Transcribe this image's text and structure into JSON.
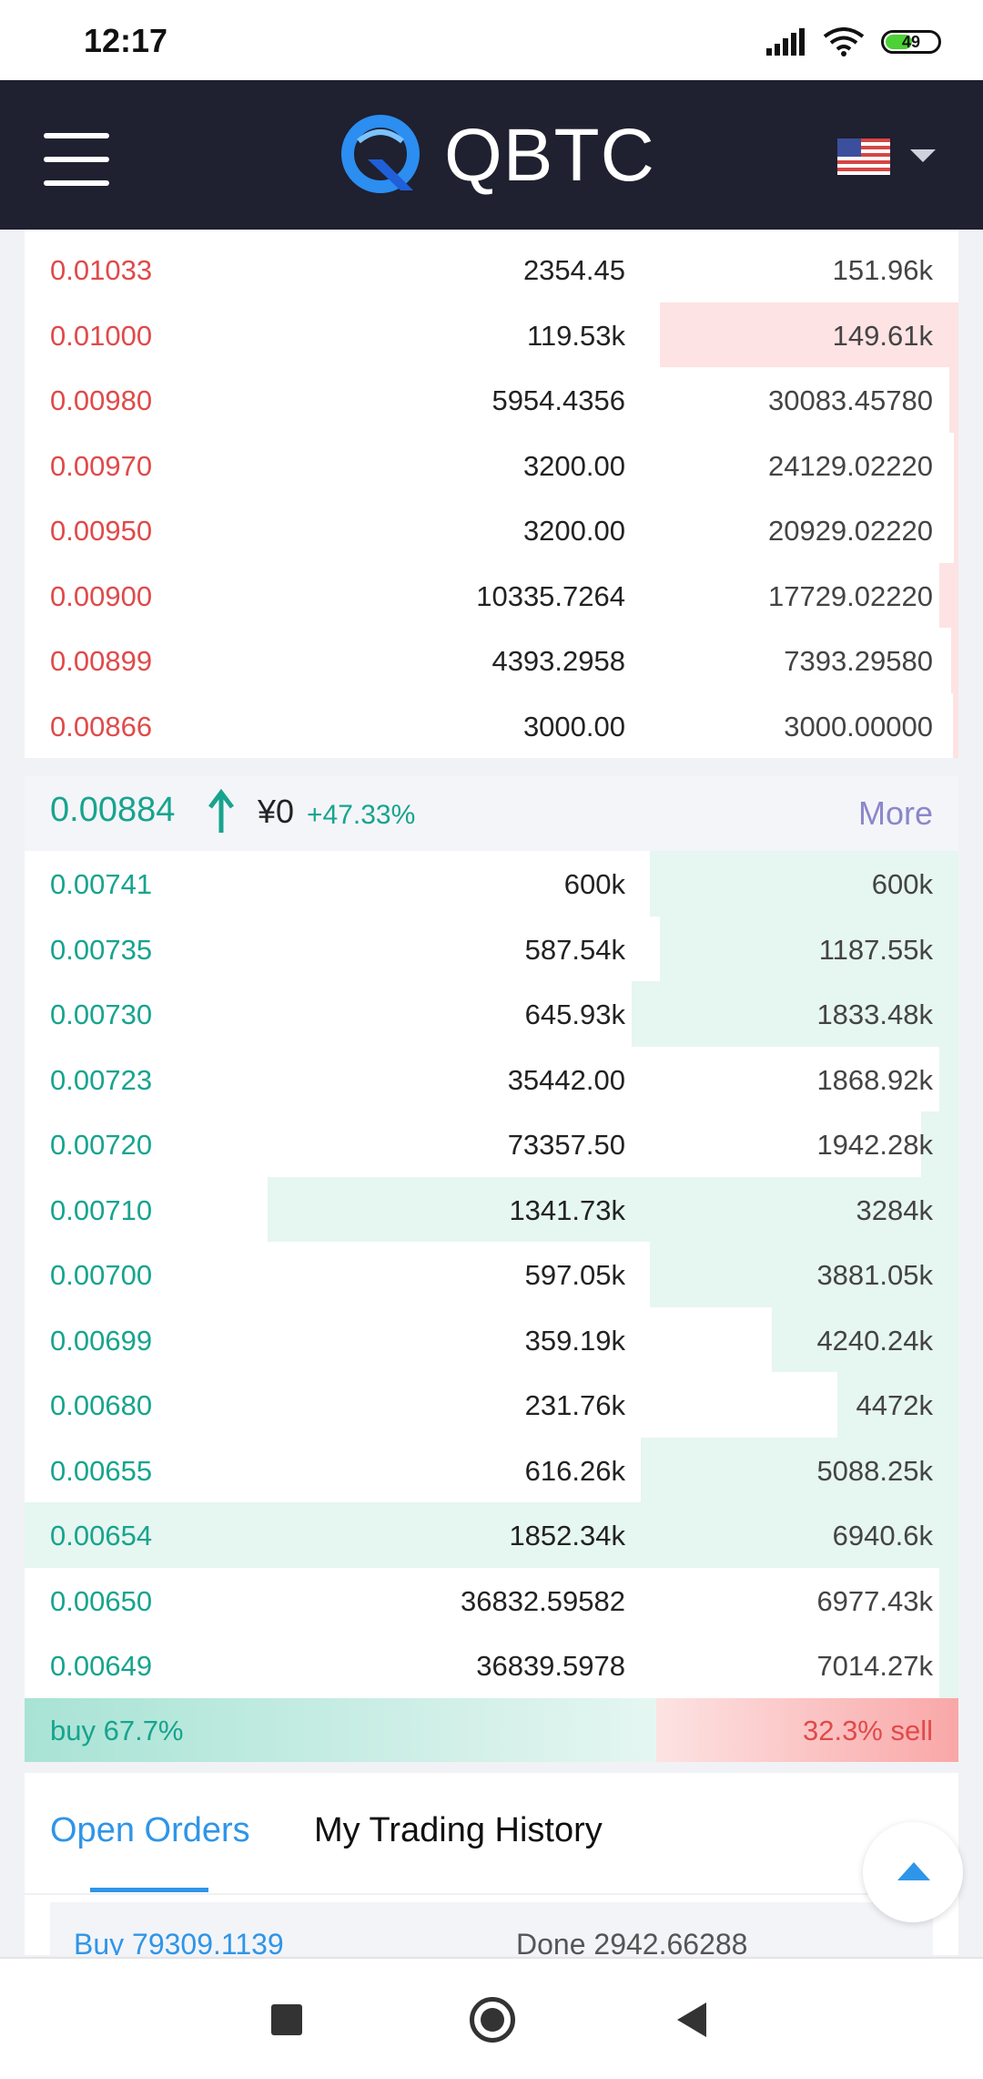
{
  "status": {
    "time": "12:17",
    "battery": "49"
  },
  "header": {
    "logo_text": "QBTC"
  },
  "asks": [
    {
      "price": "0.01033",
      "amount": "2354.45",
      "total": "151.96k",
      "depth": 0
    },
    {
      "price": "0.01000",
      "amount": "119.53k",
      "total": "149.61k",
      "depth": 0.32
    },
    {
      "price": "0.00980",
      "amount": "5954.4356",
      "total": "30083.45780",
      "depth": 0.01
    },
    {
      "price": "0.00970",
      "amount": "3200.00",
      "total": "24129.02220",
      "depth": 0.005
    },
    {
      "price": "0.00950",
      "amount": "3200.00",
      "total": "20929.02220",
      "depth": 0.005
    },
    {
      "price": "0.00900",
      "amount": "10335.7264",
      "total": "17729.02220",
      "depth": 0.02
    },
    {
      "price": "0.00899",
      "amount": "4393.2958",
      "total": "7393.29580",
      "depth": 0.008
    },
    {
      "price": "0.00866",
      "amount": "3000.00",
      "total": "3000.00000",
      "depth": 0.006
    }
  ],
  "summary": {
    "last_price": "0.00884",
    "cny": "¥0",
    "change": "+47.33%",
    "more": "More"
  },
  "bids": [
    {
      "price": "0.00741",
      "amount": "600k",
      "total": "600k",
      "depth": 0.33
    },
    {
      "price": "0.00735",
      "amount": "587.54k",
      "total": "1187.55k",
      "depth": 0.32
    },
    {
      "price": "0.00730",
      "amount": "645.93k",
      "total": "1833.48k",
      "depth": 0.35
    },
    {
      "price": "0.00723",
      "amount": "35442.00",
      "total": "1868.92k",
      "depth": 0.02
    },
    {
      "price": "0.00720",
      "amount": "73357.50",
      "total": "1942.28k",
      "depth": 0.04
    },
    {
      "price": "0.00710",
      "amount": "1341.73k",
      "total": "3284k",
      "depth": 0.74
    },
    {
      "price": "0.00700",
      "amount": "597.05k",
      "total": "3881.05k",
      "depth": 0.33
    },
    {
      "price": "0.00699",
      "amount": "359.19k",
      "total": "4240.24k",
      "depth": 0.2
    },
    {
      "price": "0.00680",
      "amount": "231.76k",
      "total": "4472k",
      "depth": 0.13
    },
    {
      "price": "0.00655",
      "amount": "616.26k",
      "total": "5088.25k",
      "depth": 0.34
    },
    {
      "price": "0.00654",
      "amount": "1852.34k",
      "total": "6940.6k",
      "depth": 1.0
    },
    {
      "price": "0.00650",
      "amount": "36832.59582",
      "total": "6977.43k",
      "depth": 0.02
    },
    {
      "price": "0.00649",
      "amount": "36839.5978",
      "total": "7014.27k",
      "depth": 0.02
    }
  ],
  "ratio": {
    "buy_label": "buy 67.7%",
    "sell_label": "32.3% sell",
    "buy_fraction": 0.677
  },
  "orders": {
    "tab_open": "Open Orders",
    "tab_history": "My Trading History",
    "first_order_side": "Buy 79309.1139",
    "first_order_done": "Done 2942.66288"
  },
  "colors": {
    "ask": "#e04a4a",
    "bid": "#17a48e",
    "accent": "#2f95e8",
    "header_bg": "#1f2030"
  }
}
